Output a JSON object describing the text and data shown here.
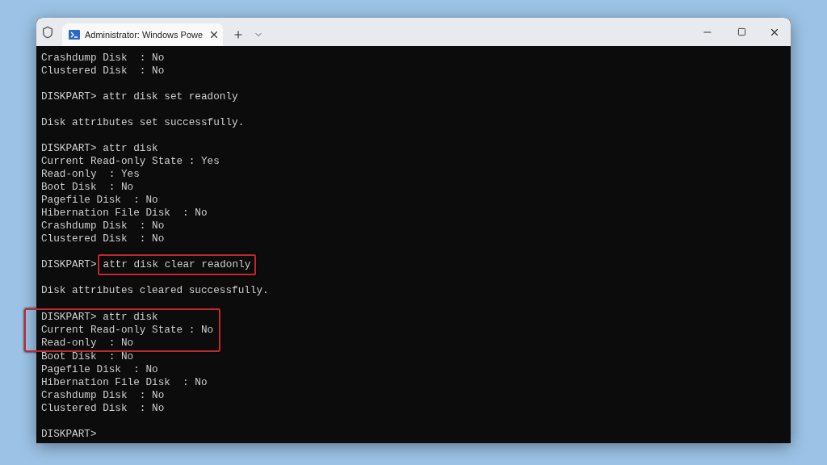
{
  "window": {
    "tab_title": "Administrator: Windows Powe"
  },
  "terminal": {
    "lines": [
      {
        "kind": "output",
        "text": "Crashdump Disk  : No"
      },
      {
        "kind": "output",
        "text": "Clustered Disk  : No"
      },
      {
        "kind": "blank"
      },
      {
        "kind": "command",
        "prompt": "DISKPART>",
        "text": "attr disk set readonly"
      },
      {
        "kind": "blank"
      },
      {
        "kind": "output",
        "text": "Disk attributes set successfully."
      },
      {
        "kind": "blank"
      },
      {
        "kind": "command",
        "prompt": "DISKPART>",
        "text": "attr disk"
      },
      {
        "kind": "output",
        "text": "Current Read-only State : Yes"
      },
      {
        "kind": "output",
        "text": "Read-only  : Yes"
      },
      {
        "kind": "output",
        "text": "Boot Disk  : No"
      },
      {
        "kind": "output",
        "text": "Pagefile Disk  : No"
      },
      {
        "kind": "output",
        "text": "Hibernation File Disk  : No"
      },
      {
        "kind": "output",
        "text": "Crashdump Disk  : No"
      },
      {
        "kind": "output",
        "text": "Clustered Disk  : No"
      },
      {
        "kind": "blank"
      },
      {
        "kind": "command",
        "prompt": "DISKPART>",
        "text": "attr disk clear readonly",
        "command_boxed": true
      },
      {
        "kind": "blank"
      },
      {
        "kind": "output",
        "text": "Disk attributes cleared successfully."
      },
      {
        "kind": "blank"
      },
      {
        "kind": "command",
        "prompt": "DISKPART>",
        "text": "attr disk",
        "boxed": true
      },
      {
        "kind": "output",
        "text": "Current Read-only State : No",
        "boxed": true
      },
      {
        "kind": "output",
        "text": "Read-only  : No",
        "boxed": true
      },
      {
        "kind": "output",
        "text": "Boot Disk  : No"
      },
      {
        "kind": "output",
        "text": "Pagefile Disk  : No"
      },
      {
        "kind": "output",
        "text": "Hibernation File Disk  : No"
      },
      {
        "kind": "output",
        "text": "Crashdump Disk  : No"
      },
      {
        "kind": "output",
        "text": "Clustered Disk  : No"
      },
      {
        "kind": "blank"
      },
      {
        "kind": "command",
        "prompt": "DISKPART>"
      }
    ]
  }
}
